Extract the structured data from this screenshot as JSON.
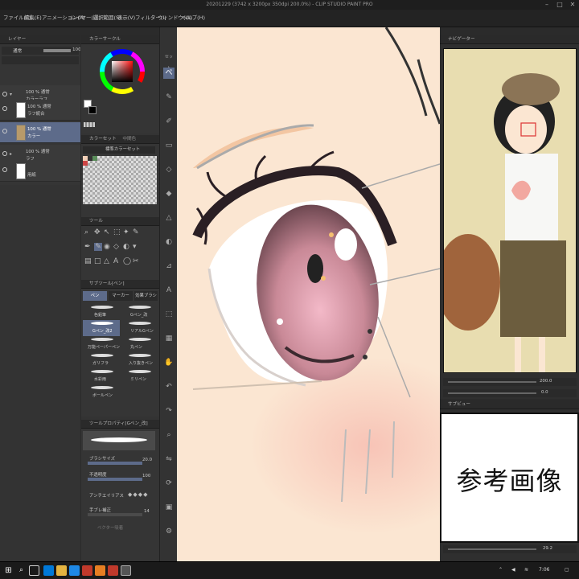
{
  "window": {
    "title": "20201229 (3742 x 3200px 350dpi 200.0%) - CLIP STUDIO PAINT PRO"
  },
  "menu": [
    {
      "label": "ファイル(F)"
    },
    {
      "label": "編集(E)"
    },
    {
      "label": "アニメーション(A)"
    },
    {
      "label": "レイヤー(L)"
    },
    {
      "label": "選択範囲(S)"
    },
    {
      "label": "表示(V)"
    },
    {
      "label": "フィルター(I)"
    },
    {
      "label": "ウィンドウ(W)"
    },
    {
      "label": "ヘルプ(H)"
    }
  ],
  "layers_panel": {
    "title": "レイヤー",
    "blend_mode": "通常",
    "opacity": "100",
    "layers": [
      {
        "line1": "100 % 通常",
        "line2": "カラーラフ"
      },
      {
        "line1": "100 % 通常",
        "line2": "ラフ統合"
      },
      {
        "line1": "100 % 通常",
        "line2": "カラー"
      },
      {
        "line1": "100 % 通常",
        "line2": "ラフ"
      },
      {
        "line1": "",
        "line2": "用紙"
      }
    ]
  },
  "color_panel": {
    "title": "カラーサークル",
    "main_color": "#ffffff",
    "sub_color": "#000000"
  },
  "color_set": {
    "title": "カラーセット",
    "tab2": "中間色",
    "set_name": "標準カラーセット"
  },
  "tool_panel": {
    "title": "ツール"
  },
  "subtool_panel": {
    "title": "サブツール[ペン]",
    "tabs": [
      {
        "label": "ペン"
      },
      {
        "label": "マーカー"
      },
      {
        "label": "効果ブラシ"
      }
    ],
    "brushes": [
      {
        "label": "色鉛筆"
      },
      {
        "label": "Gペン_改"
      },
      {
        "label": "Gペン_改2"
      },
      {
        "label": "リアルGペン"
      },
      {
        "label": "万能ペーパーペン"
      },
      {
        "label": "丸ペン"
      },
      {
        "label": "ガリフラ"
      },
      {
        "label": "入り抜きペン"
      },
      {
        "label": "水彩雨"
      },
      {
        "label": "ミリペン"
      },
      {
        "label": "ボールペン"
      }
    ]
  },
  "tool_property": {
    "title": "ツールプロパティ[Gペン_改]",
    "props": [
      {
        "label": "ブラシサイズ",
        "value": "20.0"
      },
      {
        "label": "不透明度",
        "value": "100"
      },
      {
        "label": "アンチエイリアス",
        "value": ""
      },
      {
        "label": "手ブレ補正",
        "value": "14"
      },
      {
        "label": "ベクター吸着",
        "value": ""
      }
    ]
  },
  "navigator": {
    "title": "ナビゲーター",
    "zoom": "200.0",
    "angle": "0.0"
  },
  "subview": {
    "title": "サブビュー",
    "ref_label": "参考画像",
    "zoom": "29.2"
  },
  "canvas": {
    "skin_color": "#fbe6d2",
    "iris_color": "#c98997"
  },
  "taskbar": {
    "time": "7:06"
  }
}
